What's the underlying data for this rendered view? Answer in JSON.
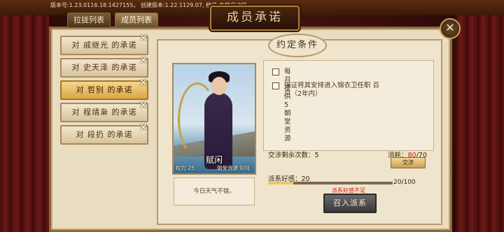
{
  "version_text": "版本号:1.23.0116.18.1427155， 创建版本:1.22.1129.07, 档位:本地自动档",
  "tabs": [
    {
      "label": "拉拢列表",
      "active": false
    },
    {
      "label": "成员列表",
      "active": true
    }
  ],
  "window_title": "成员承诺",
  "close_icon": "✕",
  "promises": [
    {
      "label": "对 戚继光 的承诺",
      "active": false
    },
    {
      "label": "对 史天泽 的承诺",
      "active": false
    },
    {
      "label": "对 哲别 的承诺",
      "active": true
    },
    {
      "label": "对 程靖枭 的承诺",
      "active": false
    },
    {
      "label": "对 段扔 的承诺",
      "active": false
    }
  ],
  "badge_icon": "✕",
  "conditions_title": "约定条件",
  "character": {
    "name": "赋闲",
    "force_label": "权力 25",
    "resource_label": "朝堂资源 0/月"
  },
  "weather_text": "今日天气不错。",
  "conditions": [
    {
      "text": "每月提供 5 朝堂资源"
    },
    {
      "text": "保证将其安排进入锦衣卫任职 百",
      "text2": "户（2年内）"
    }
  ],
  "negotiation": {
    "label": "交涉剩余次数：",
    "remaining": "5",
    "cost_label": "消耗：",
    "cost_current": "80",
    "cost_total": "/70",
    "button": "交涉"
  },
  "favor": {
    "label": "派系好感：",
    "value": "20",
    "progress_text": "20/100",
    "fraction": 0.2,
    "warning": "派系好感不足"
  },
  "summon_button": "召入派系",
  "colors": {
    "accent_gold": "#d8a848",
    "warning_red": "#d81a14",
    "panel_bg": "#e9dcc0"
  }
}
